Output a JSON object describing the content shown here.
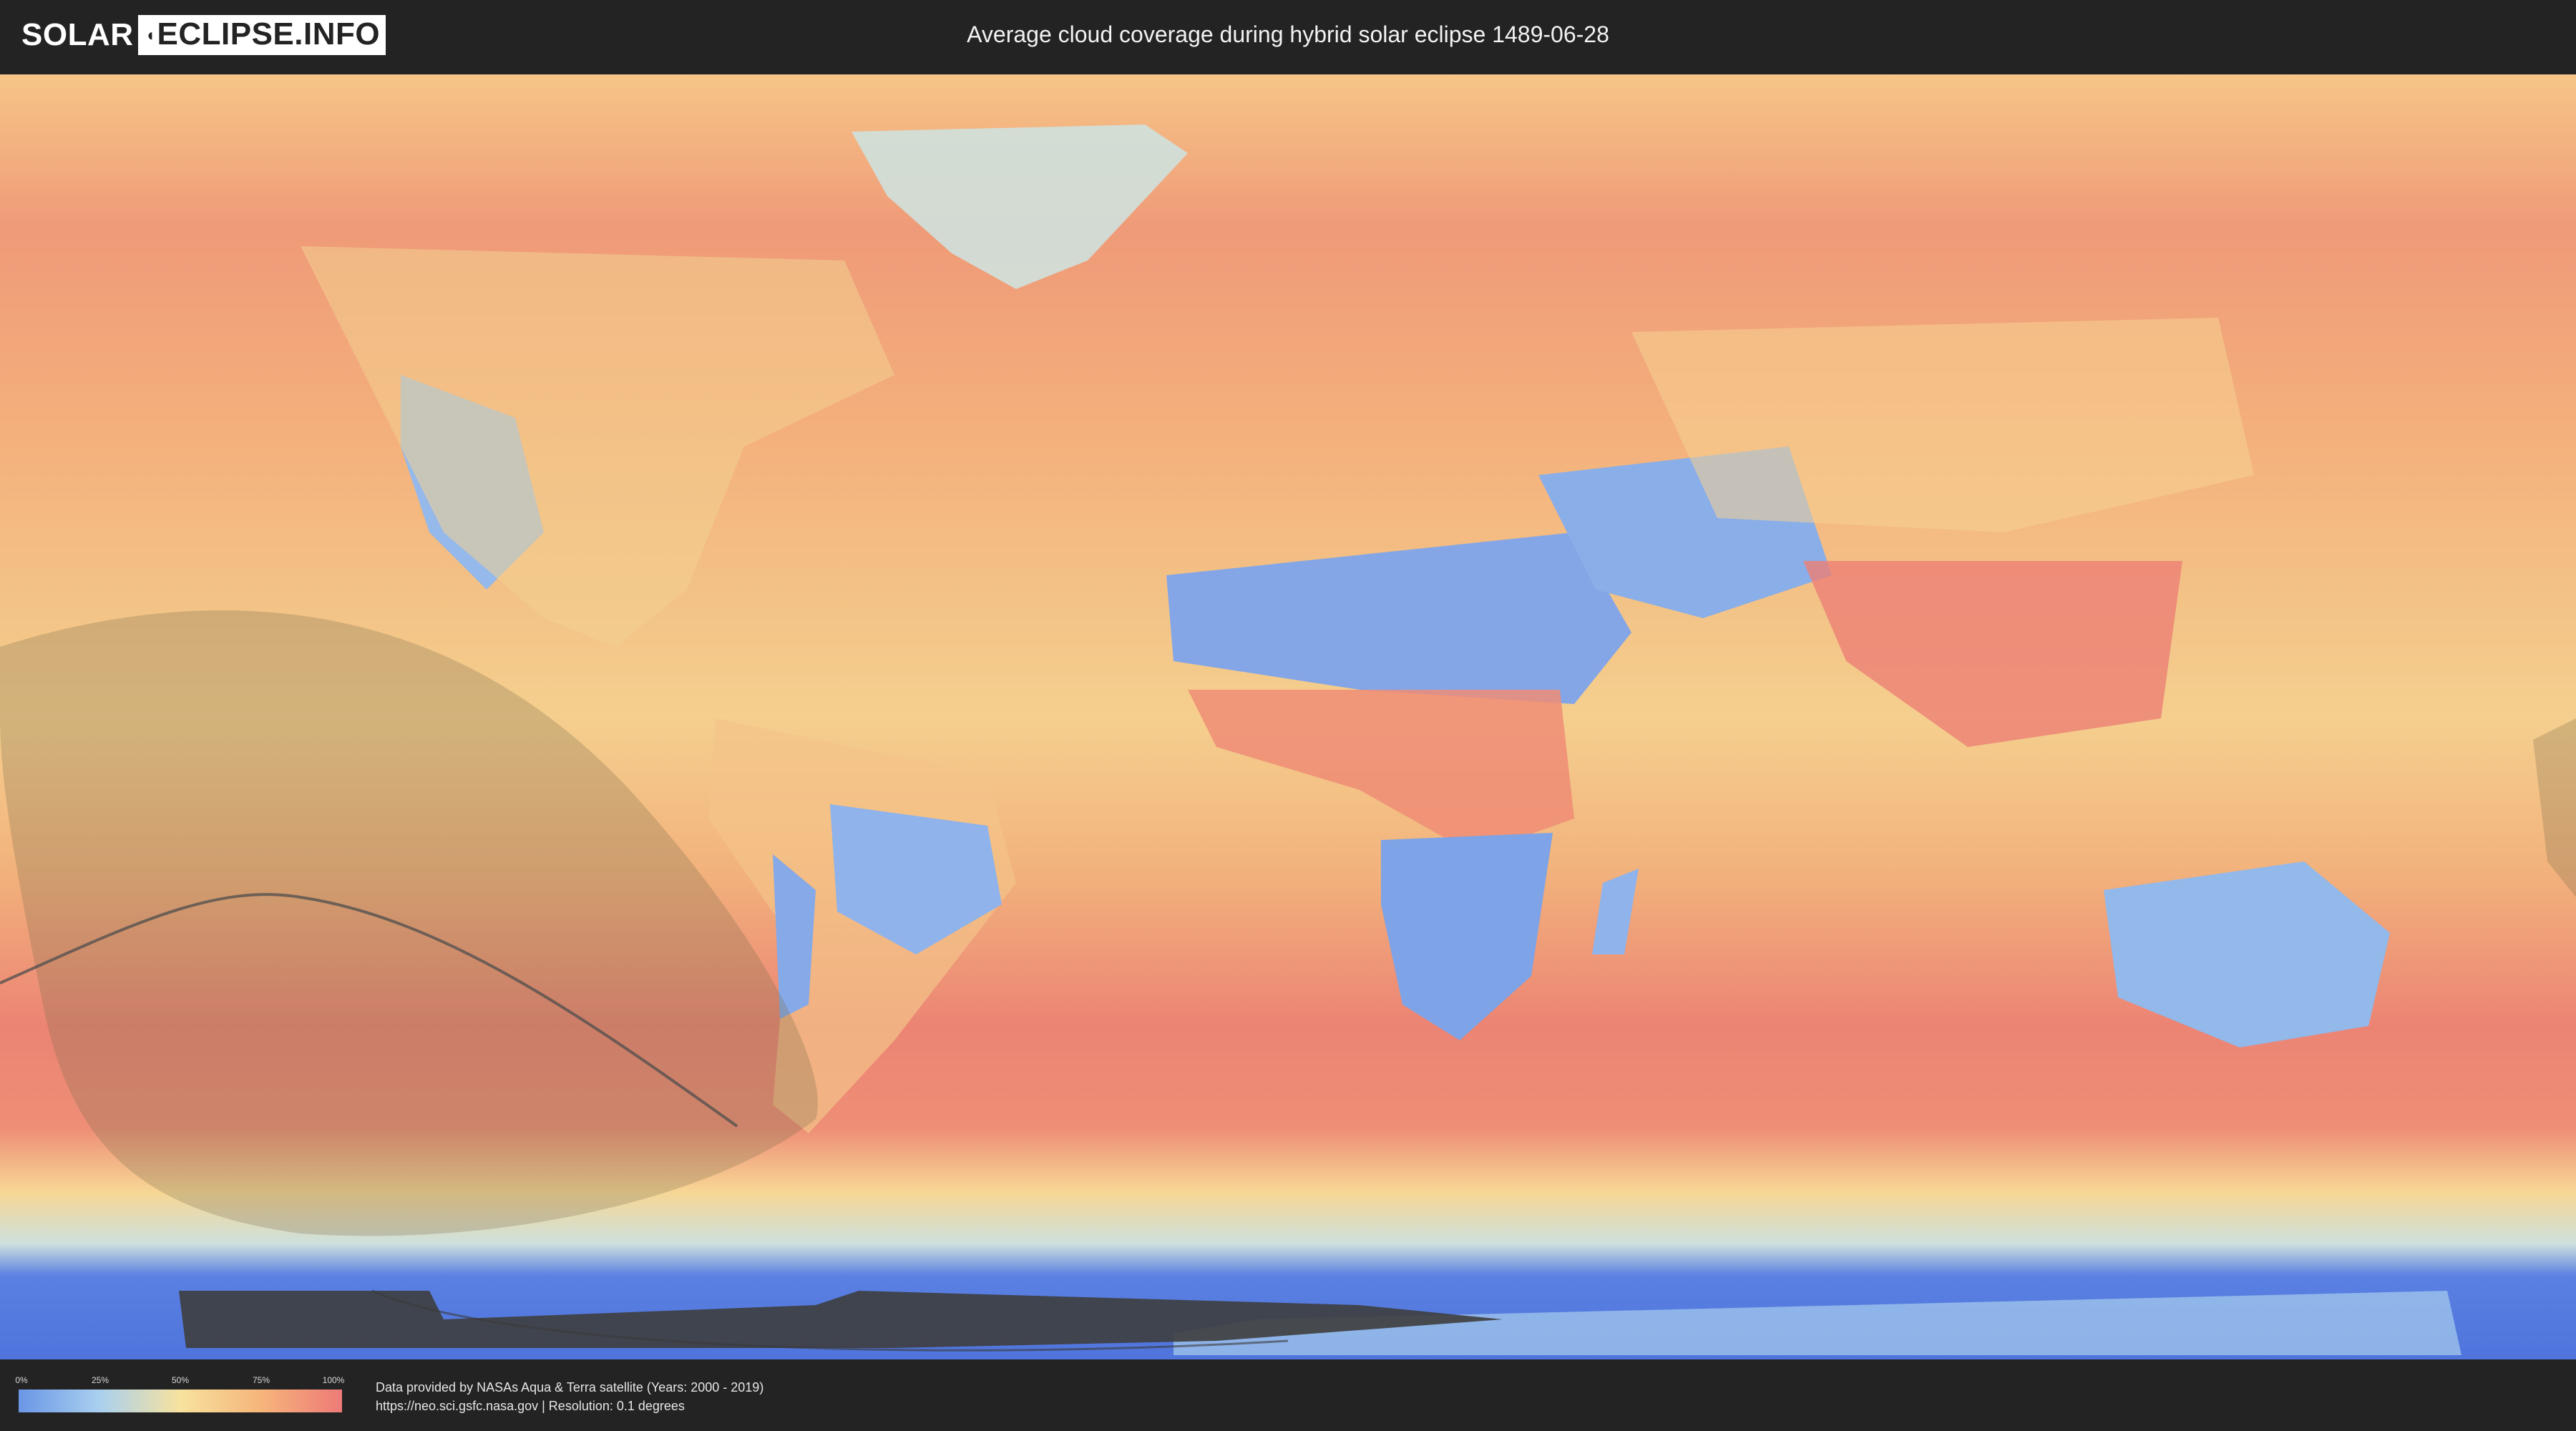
{
  "header": {
    "logo_solar": "SOLAR",
    "logo_eclipse": "ECLIPSE.INFO",
    "title": "Average cloud coverage during hybrid solar eclipse 1489-06-28"
  },
  "map": {
    "description_icon": "world-map",
    "colors": {
      "clear": "#6a96e6",
      "low": "#a9d0ef",
      "mid": "#f7e29e",
      "high": "#f6b57a",
      "overcast": "#ee7a78",
      "ocean_base": "#ec8676",
      "eclipse_shadow": "#7a6a4a",
      "antarctic_blue": "#5a7ee0"
    }
  },
  "legend": {
    "ticks": [
      "0%",
      "25%",
      "50%",
      "75%",
      "100%"
    ]
  },
  "footer": {
    "credit_line1": "Data provided by NASAs Aqua & Terra satellite (Years: 2000 - 2019)",
    "credit_line2": "https://neo.sci.gsfc.nasa.gov | Resolution: 0.1 degrees"
  }
}
